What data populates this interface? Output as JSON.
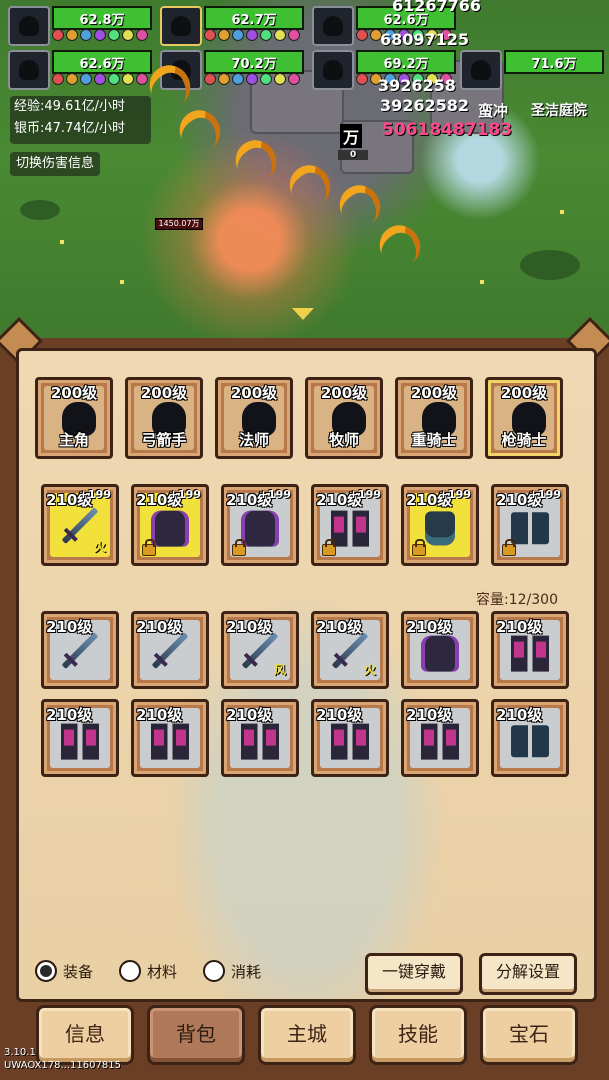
{
  "battle": {
    "heroes": [
      {
        "hp": "62.8万"
      },
      {
        "hp": "62.7万"
      },
      {
        "hp": "62.6万"
      },
      {
        "hp": "62.6万"
      },
      {
        "hp": "70.2万"
      },
      {
        "hp": "69.2万"
      },
      {
        "hp": "71.6万"
      }
    ],
    "exp_rate": "经验:49.61亿/小时",
    "coin_rate": "银币:47.74亿/小时",
    "toggle_damage": "切换伤害信息",
    "location": "圣洁庭院",
    "damage_numbers": [
      "61267766",
      "68097125",
      "3926258",
      "39262582",
      "50618487183"
    ],
    "enemy_label": "蛮冲",
    "boss_name": "万",
    "boss_hp_text": "1450.07万",
    "boss_counter": "0"
  },
  "hero_tabs": [
    {
      "level": "200级",
      "name": "主角"
    },
    {
      "level": "200级",
      "name": "弓箭手"
    },
    {
      "level": "200级",
      "name": "法师"
    },
    {
      "level": "200级",
      "name": "牧师"
    },
    {
      "level": "200级",
      "name": "重骑士"
    },
    {
      "level": "200级",
      "name": "枪骑士"
    }
  ],
  "equipped": [
    {
      "level": "210级",
      "plus": "+199",
      "type": "sword",
      "element": "火"
    },
    {
      "level": "210级",
      "plus": "+199",
      "type": "armor",
      "element": ""
    },
    {
      "level": "210级",
      "plus": "+199",
      "type": "armor",
      "element": ""
    },
    {
      "level": "210级",
      "plus": "+199",
      "type": "greaves",
      "element": ""
    },
    {
      "level": "210级",
      "plus": "+199",
      "type": "glove",
      "element": ""
    },
    {
      "level": "210级",
      "plus": "+199",
      "type": "boots",
      "element": ""
    }
  ],
  "capacity": "容量:12/300",
  "inventory": [
    {
      "level": "210级",
      "type": "sword",
      "element": ""
    },
    {
      "level": "210级",
      "type": "sword",
      "element": ""
    },
    {
      "level": "210级",
      "type": "sword",
      "element": "风"
    },
    {
      "level": "210级",
      "type": "sword",
      "element": "火"
    },
    {
      "level": "210级",
      "type": "armor",
      "element": ""
    },
    {
      "level": "210级",
      "type": "greaves",
      "element": ""
    },
    {
      "level": "210级",
      "type": "greaves",
      "element": ""
    },
    {
      "level": "210级",
      "type": "greaves",
      "element": ""
    },
    {
      "level": "210级",
      "type": "greaves",
      "element": ""
    },
    {
      "level": "210级",
      "type": "greaves",
      "element": ""
    },
    {
      "level": "210级",
      "type": "greaves",
      "element": ""
    },
    {
      "level": "210级",
      "type": "boots",
      "element": ""
    }
  ],
  "filters": [
    {
      "label": "装备",
      "selected": true
    },
    {
      "label": "材料",
      "selected": false
    },
    {
      "label": "消耗",
      "selected": false
    }
  ],
  "actions": {
    "equip_all": "一键穿戴",
    "decompose": "分解设置"
  },
  "nav": [
    "信息",
    "背包",
    "主城",
    "技能",
    "宝石"
  ],
  "version": "3.10.1",
  "uid": "UWAOX178...11607815",
  "colors": {
    "hp_green": "#3fbf32",
    "slot_yellow": "#f2e13a",
    "panel_brown": "#6a3f26",
    "parchment": "#efd8b2"
  }
}
